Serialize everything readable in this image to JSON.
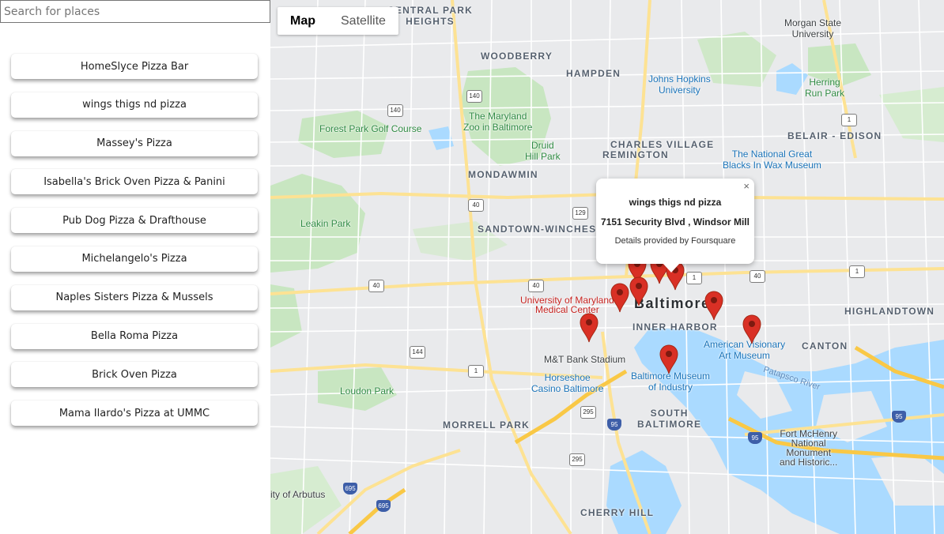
{
  "search": {
    "placeholder": "Search for places"
  },
  "places": [
    "HomeSlyce Pizza Bar",
    "wings thigs nd pizza",
    "Massey's Pizza",
    "Isabella's Brick Oven Pizza & Panini",
    "Pub Dog Pizza & Drafthouse",
    "Michelangelo's Pizza",
    "Naples Sisters Pizza & Mussels",
    "Bella Roma Pizza",
    "Brick Oven Pizza",
    "Mama Ilardo's Pizza at UMMC"
  ],
  "map": {
    "type_buttons": {
      "map": "Map",
      "satellite": "Satellite"
    },
    "info_window": {
      "name": "wings thigs nd pizza",
      "address": "7151 Security Blvd , Windsor Mill",
      "credit": "Details provided by Foursquare",
      "close": "×"
    },
    "marker_color": "#d93025",
    "water_color": "#aadaff",
    "park_color": "#c8e6c1",
    "labels": {
      "central_park_heights": "CENTRAL PARK\nHEIGHTS",
      "woodberry": "WOODBERRY",
      "hampden": "HAMPDEN",
      "johns_hopkins": "Johns Hopkins\nUniversity",
      "morgan_state": "Morgan State\nUniversity",
      "herring_run": "Herring\nRun Park",
      "forest_park_golf": "Forest Park Golf Course",
      "maryland_zoo": "The Maryland\nZoo in Baltimore",
      "druid_hill": "Druid\nHill Park",
      "charles_village": "CHARLES VILLAGE",
      "remington": "REMINGTON",
      "belair_edison": "BELAIR - EDISON",
      "wax_museum": "The National Great\nBlacks In Wax Museum",
      "mondawmin": "MONDAWMIN",
      "leakin_park": "Leakin Park",
      "sandtown": "SANDTOWN-WINCHESTER",
      "umd_medical": "University of Maryland\nMedical Center",
      "baltimore": "Baltimore",
      "highlandtown": "HIGHLANDTOWN",
      "inner_harbor": "INNER HARBOR",
      "visionary": "American Visionary\nArt Museum",
      "canton": "CANTON",
      "mt_bank": "M&T Bank Stadium",
      "horseshoe": "Horseshoe\nCasino Baltimore",
      "museum_industry": "Baltimore Museum\nof Industry",
      "loudon_park": "Loudon Park",
      "south_baltimore": "SOUTH\nBALTIMORE",
      "morrell_park": "MORRELL PARK",
      "fort_mchenry": "Fort McHenry\nNational\nMonument\nand Historic...",
      "arbutus": "ity of Arbutus",
      "cherry_hill": "CHERRY HILL",
      "patapsco": "Patapsco River"
    },
    "shields": [
      "140",
      "140",
      "129",
      "40",
      "40",
      "40",
      "40",
      "1",
      "1",
      "144",
      "295",
      "295",
      "95",
      "95",
      "95",
      "695",
      "695",
      "1",
      "140",
      "1"
    ]
  }
}
